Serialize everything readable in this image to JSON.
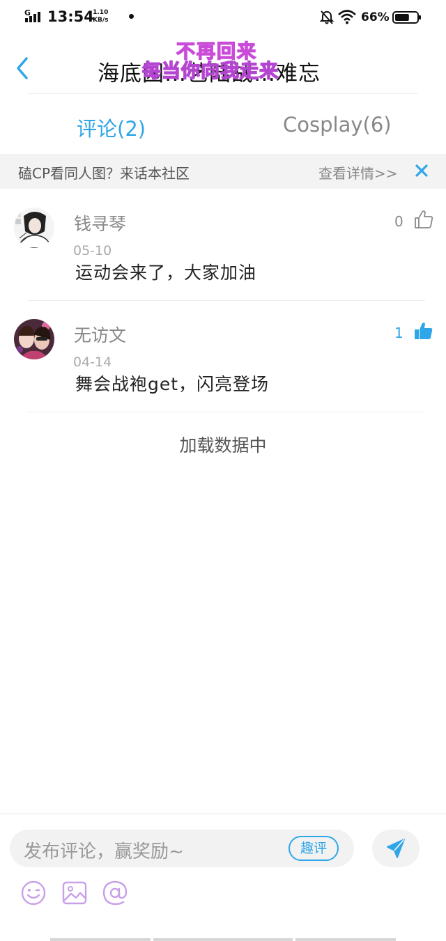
{
  "status_bar": {
    "network": "G",
    "time": "13:54",
    "speed_value": "1.10",
    "speed_unit": "KB/s",
    "battery_percent": "66%",
    "battery_level": 0.66
  },
  "header": {
    "title": "海底囚…艺陆战…难忘",
    "watermark_line1": "不再回来",
    "watermark_line2": "每当你向我走来"
  },
  "tabs": [
    {
      "label": "评论(2)",
      "active": true
    },
    {
      "label": "Cosplay(6)",
      "active": false
    }
  ],
  "banner": {
    "text": "磕CP看同人图？来话本社区",
    "link": "查看详情>>"
  },
  "comments": [
    {
      "user": "钱寻琴",
      "date": "05-10",
      "text": "运动会来了，大家加油",
      "likes": "0",
      "liked": false
    },
    {
      "user": "无访文",
      "date": "04-14",
      "text": "舞会战袍get，闪亮登场",
      "likes": "1",
      "liked": true
    }
  ],
  "loading_text": "加载数据中",
  "composer": {
    "placeholder": "发布评论，赢奖励~",
    "fun_comment_label": "趣评"
  },
  "colors": {
    "accent": "#2fa6e8",
    "watermark": "#c94bd8",
    "tool_icons": "#c7a0e8"
  },
  "icons": [
    "back-arrow-icon",
    "thumb-up-icon",
    "close-icon",
    "send-icon",
    "emoji-icon",
    "image-icon",
    "at-icon",
    "bell-off-icon",
    "wifi-icon",
    "battery-icon"
  ]
}
